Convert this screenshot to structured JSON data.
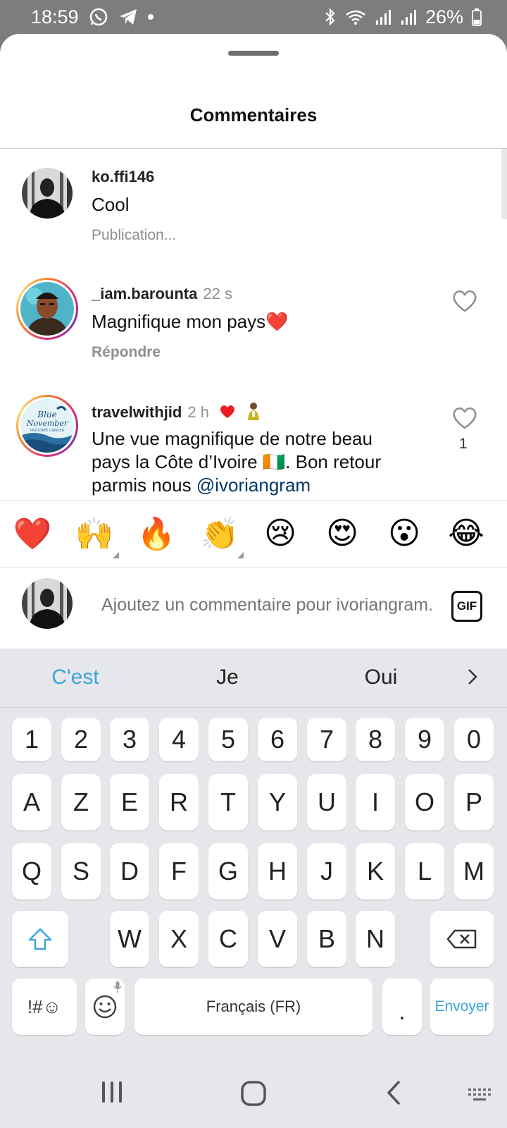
{
  "status_bar": {
    "time": "18:59",
    "battery": "26%"
  },
  "sheet": {
    "title": "Commentaires"
  },
  "comments": [
    {
      "user": "ko.ffi146",
      "time": "",
      "text": "Cool",
      "action": "Publication..."
    },
    {
      "user": "_iam.barounta",
      "time": "22 s",
      "text": "Magnifique mon pays❤️",
      "action": "Répondre"
    },
    {
      "user": "travelwithjid",
      "time": "2 h",
      "text_line1": "Une vue magnifique de notre beau",
      "text_line2": "pays la Côte d’Ivoire 🇨🇮. Bon retour",
      "text_line3_prefix": "parmis nous ",
      "mention": "@ivoriangram",
      "likes": "1"
    }
  ],
  "avatar_labels": {
    "blue_november_line1": "Blue",
    "blue_november_line2": "November",
    "blue_november_sub": "PROSTATE CANCER"
  },
  "emoji_bar": [
    "❤️",
    "🙌",
    "🔥",
    "👏",
    "😢",
    "😍",
    "😮",
    "😂"
  ],
  "compose": {
    "placeholder": "Ajoutez un commentaire pour ivoriangram...",
    "gif_label": "GIF"
  },
  "keyboard": {
    "suggestions": [
      "C'est",
      "Je",
      "Oui"
    ],
    "row_numbers": [
      "1",
      "2",
      "3",
      "4",
      "5",
      "6",
      "7",
      "8",
      "9",
      "0"
    ],
    "row1": [
      "A",
      "Z",
      "E",
      "R",
      "T",
      "Y",
      "U",
      "I",
      "O",
      "P"
    ],
    "row2": [
      "Q",
      "S",
      "D",
      "F",
      "G",
      "H",
      "J",
      "K",
      "L",
      "M"
    ],
    "row3": [
      "W",
      "X",
      "C",
      "V",
      "B",
      "N"
    ],
    "symbols_label": "!#☺",
    "space_label": "Français (FR)",
    "period_label": ".",
    "send_label": "Envoyer"
  },
  "colors": {
    "accent": "#3ba4de",
    "mention": "#00376b",
    "heart": "#ed1c24"
  }
}
